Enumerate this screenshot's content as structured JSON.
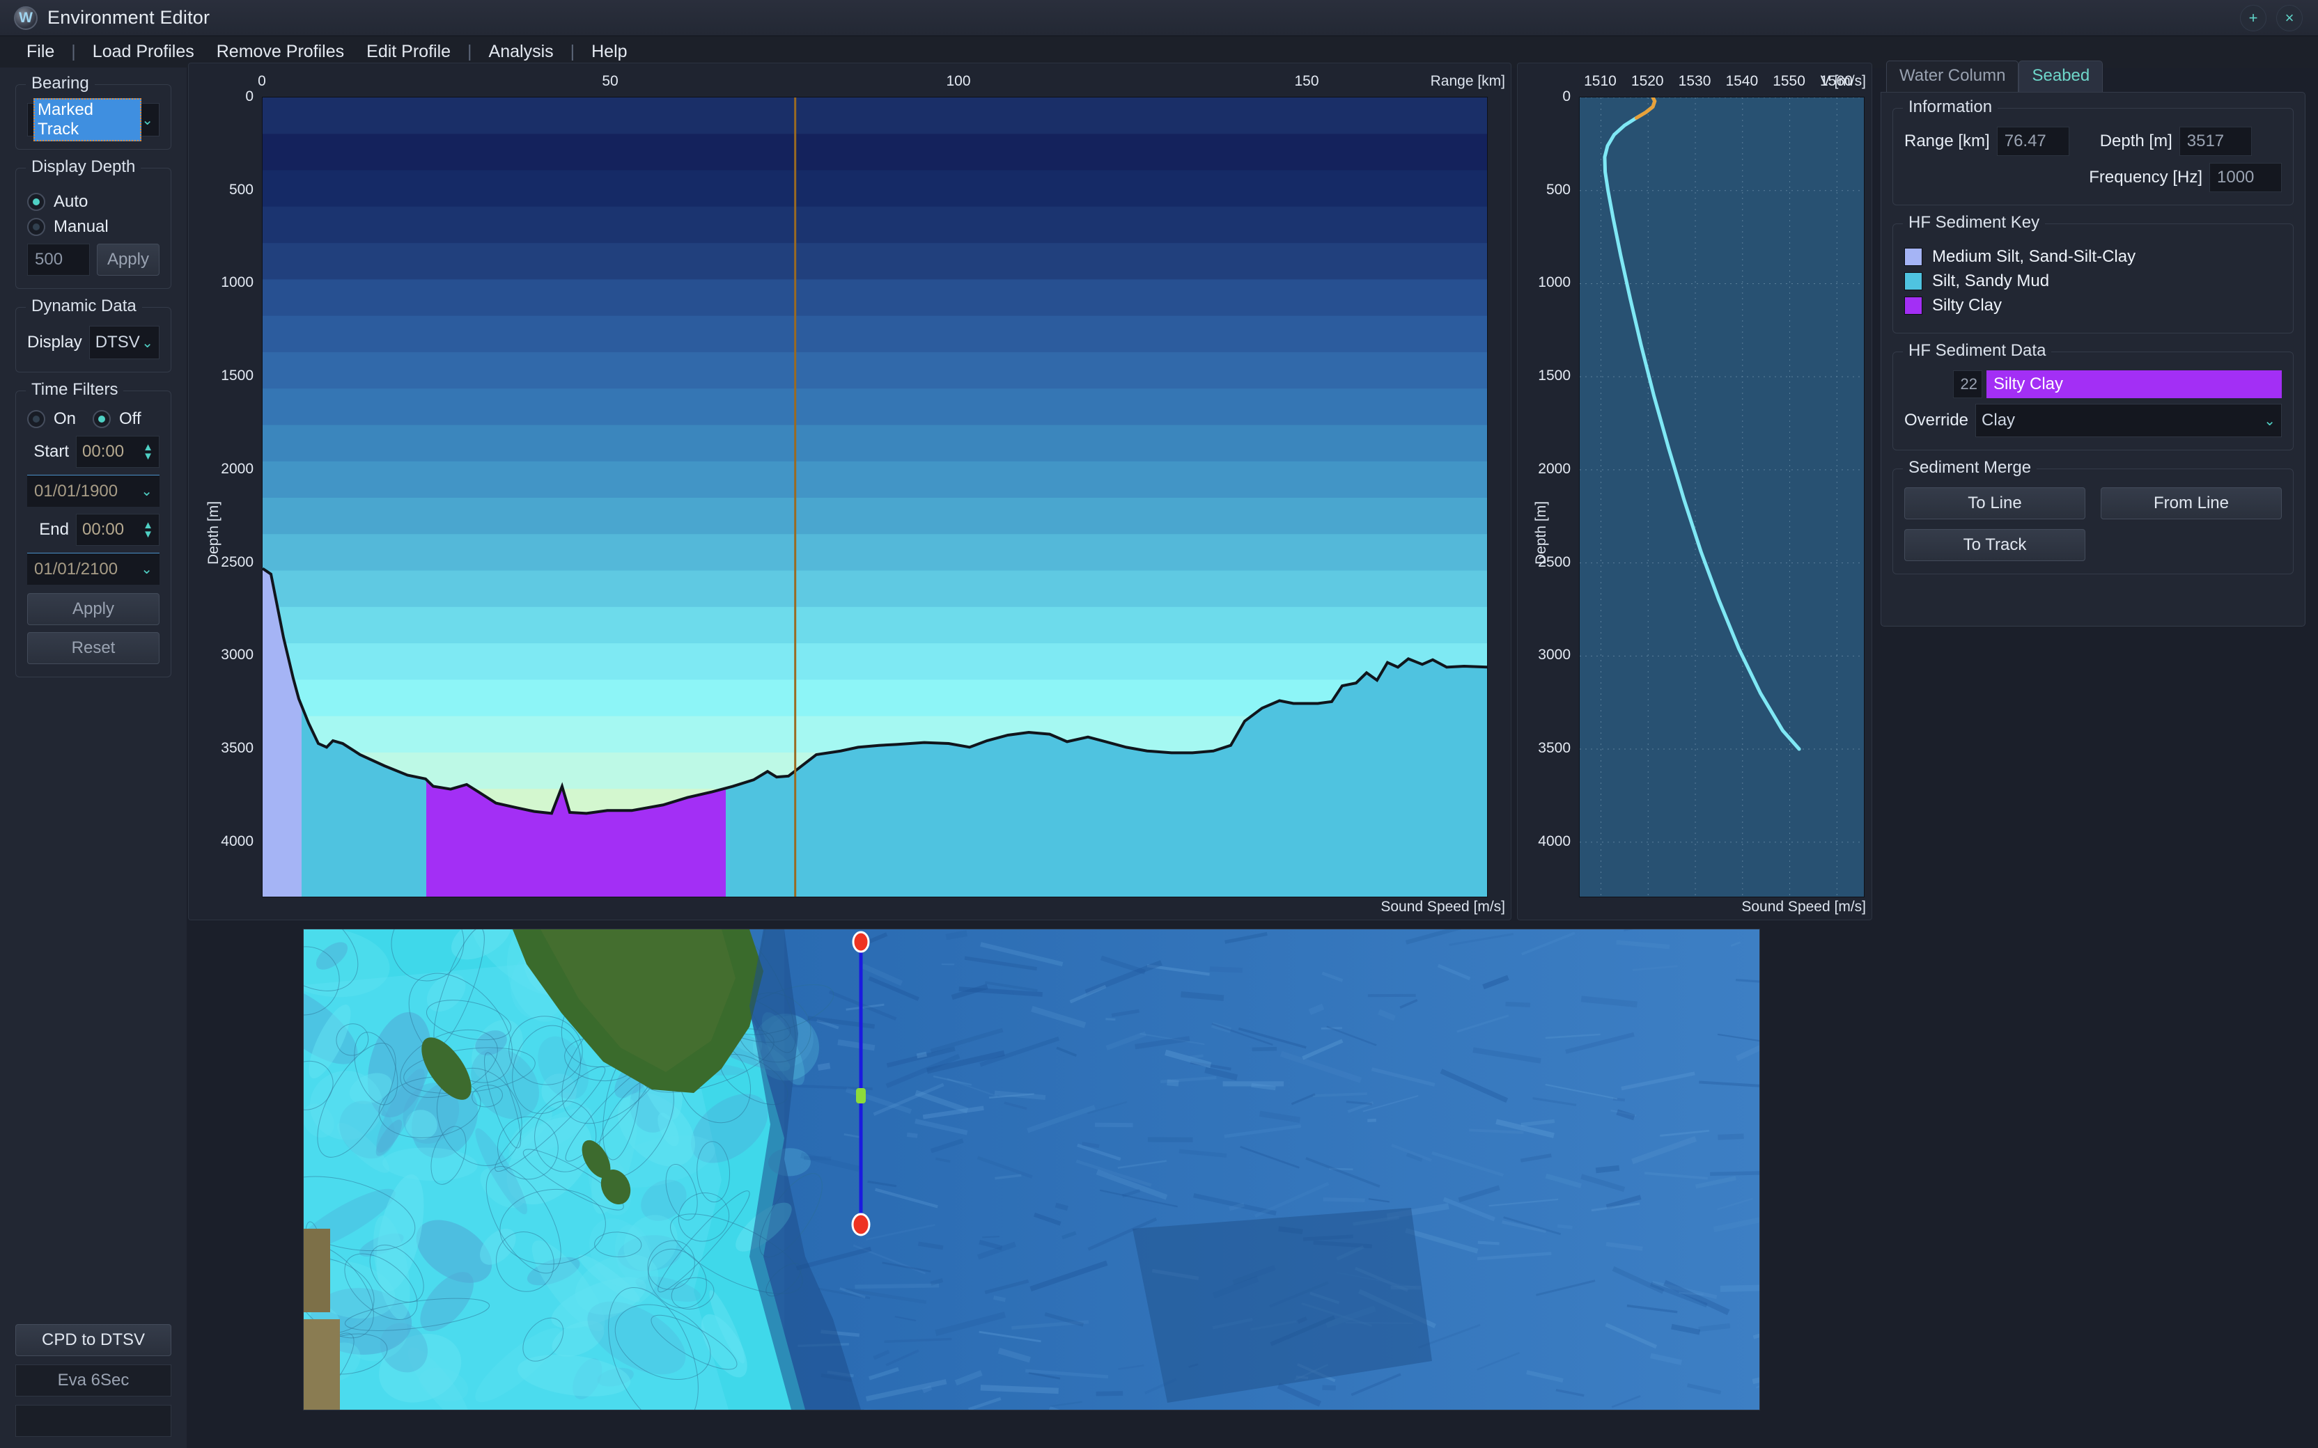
{
  "window": {
    "title": "Environment Editor",
    "logo_icon": "app-logo-icon",
    "maximize_label": "+",
    "close_label": "×"
  },
  "menu": {
    "items": [
      "File",
      "|",
      "Load Profiles",
      "Remove Profiles",
      "Edit Profile",
      "|",
      "Analysis",
      "|",
      "Help"
    ]
  },
  "sidebar": {
    "bearing": {
      "group_label": "Bearing",
      "selected": "Marked Track",
      "chevron": "⌄"
    },
    "display_depth": {
      "group_label": "Display Depth",
      "auto_label": "Auto",
      "manual_label": "Manual",
      "auto_selected": true,
      "manual_selected": false,
      "value": "500",
      "apply_label": "Apply"
    },
    "dynamic_data": {
      "group_label": "Dynamic Data",
      "display_label": "Display",
      "selected": "DTSV",
      "chevron": "⌄"
    },
    "time_filters": {
      "group_label": "Time Filters",
      "on_label": "On",
      "off_label": "Off",
      "on_selected": false,
      "off_selected": true,
      "start_label": "Start",
      "start_time": "00:00",
      "start_date": "01/01/1900",
      "end_label": "End",
      "end_time": "00:00",
      "end_date": "01/01/2100",
      "apply_label": "Apply",
      "reset_label": "Reset",
      "chevron": "⌄"
    },
    "bottom": {
      "cpd_to_dtsv_label": "CPD to DTSV",
      "eva_label": "Eva 6Sec"
    }
  },
  "right_panel": {
    "tabs": [
      {
        "label": "Water Column",
        "active": false
      },
      {
        "label": "Seabed",
        "active": true
      }
    ],
    "information": {
      "group_label": "Information",
      "range_label": "Range [km]",
      "range_value": "76.47",
      "depth_label": "Depth [m]",
      "depth_value": "3517",
      "frequency_label": "Frequency [Hz]",
      "frequency_value": "1000"
    },
    "sediment_key": {
      "group_label": "HF Sediment Key",
      "items": [
        {
          "label": "Medium Silt, Sand-Silt-Clay",
          "color": "#a5b4f5"
        },
        {
          "label": "Silt, Sandy Mud",
          "color": "#4fc3e0"
        },
        {
          "label": "Silty Clay",
          "color": "#a32ff5"
        }
      ]
    },
    "sediment_data": {
      "group_label": "HF Sediment Data",
      "index": "22",
      "name": "Silty Clay",
      "highlight_color": "#a32ff5",
      "override_label": "Override",
      "override_value": "Clay",
      "chevron": "⌄"
    },
    "sediment_merge": {
      "group_label": "Sediment Merge",
      "to_line_label": "To Line",
      "from_line_label": "From Line",
      "to_track_label": "To Track"
    }
  },
  "chart_data": [
    {
      "type": "area",
      "name": "range-depth-profile",
      "title": "",
      "xlabel_top": "Range [km]",
      "xlabel_bottom": "Sound Speed [m/s]",
      "ylabel": "Depth [m]",
      "xticks": [
        0,
        50,
        100,
        150
      ],
      "xlim": [
        0,
        176
      ],
      "yticks": [
        0,
        500,
        1000,
        1500,
        2000,
        2500,
        3000,
        3500,
        4000
      ],
      "ylim": [
        0,
        4300
      ],
      "grid": false,
      "cursor_range_km": 76.47,
      "water_column_bands": [
        "#1a2f68",
        "#14225c",
        "#152a66",
        "#1b3470",
        "#21407d",
        "#275091",
        "#2c5c9e",
        "#3169aa",
        "#3576b4",
        "#3b86bd",
        "#4295c6",
        "#4aa6cf",
        "#54b8d9",
        "#5fc9e2",
        "#6ddbeb",
        "#7ee9f3",
        "#8df5f7",
        "#a5f8f2",
        "#bdf9e6",
        "#d3f7cf",
        "#e6f5b5",
        "#f2f2a0"
      ],
      "seabed_profile": [
        [
          0,
          2530
        ],
        [
          1.2,
          2560
        ],
        [
          3.0,
          2900
        ],
        [
          4.4,
          3120
        ],
        [
          5.2,
          3230
        ],
        [
          6.6,
          3360
        ],
        [
          8.0,
          3470
        ],
        [
          9.2,
          3490
        ],
        [
          10.1,
          3455
        ],
        [
          11.5,
          3470
        ],
        [
          14.0,
          3530
        ],
        [
          17.5,
          3590
        ],
        [
          20.8,
          3640
        ],
        [
          23.4,
          3660
        ],
        [
          24.5,
          3700
        ],
        [
          27.0,
          3715
        ],
        [
          29.3,
          3690
        ],
        [
          31.0,
          3730
        ],
        [
          33.5,
          3790
        ],
        [
          36.5,
          3815
        ],
        [
          39.0,
          3835
        ],
        [
          41.5,
          3845
        ],
        [
          43.0,
          3700
        ],
        [
          44.1,
          3840
        ],
        [
          46.5,
          3845
        ],
        [
          49.5,
          3830
        ],
        [
          53.0,
          3830
        ],
        [
          57.5,
          3800
        ],
        [
          61.0,
          3760
        ],
        [
          64.5,
          3730
        ],
        [
          67.5,
          3700
        ],
        [
          70.5,
          3665
        ],
        [
          72.5,
          3620
        ],
        [
          73.8,
          3650
        ],
        [
          75.5,
          3645
        ],
        [
          79.5,
          3530
        ],
        [
          83.0,
          3510
        ],
        [
          85.5,
          3490
        ],
        [
          88.5,
          3480
        ],
        [
          91.0,
          3475
        ],
        [
          95.0,
          3465
        ],
        [
          98.5,
          3470
        ],
        [
          101.5,
          3490
        ],
        [
          104.0,
          3455
        ],
        [
          107.0,
          3425
        ],
        [
          110.0,
          3410
        ],
        [
          113.0,
          3420
        ],
        [
          115.5,
          3460
        ],
        [
          118.5,
          3435
        ],
        [
          121.0,
          3460
        ],
        [
          124.0,
          3490
        ],
        [
          127.0,
          3510
        ],
        [
          130.5,
          3520
        ],
        [
          133.5,
          3520
        ],
        [
          136.5,
          3510
        ],
        [
          139.0,
          3480
        ],
        [
          141.0,
          3350
        ],
        [
          143.5,
          3280
        ],
        [
          146.0,
          3240
        ],
        [
          148.0,
          3255
        ],
        [
          151.5,
          3255
        ],
        [
          153.5,
          3245
        ],
        [
          155.0,
          3160
        ],
        [
          157.0,
          3145
        ],
        [
          158.5,
          3090
        ],
        [
          160.0,
          3130
        ],
        [
          161.5,
          3035
        ],
        [
          163.0,
          3060
        ],
        [
          164.5,
          3015
        ],
        [
          166.5,
          3045
        ],
        [
          168.0,
          3020
        ],
        [
          170.0,
          3060
        ],
        [
          172.5,
          3055
        ],
        [
          176.0,
          3060
        ]
      ],
      "sediment_bands": [
        {
          "x0": 0.0,
          "x1": 5.6,
          "color": "#a5b4f5",
          "sediment": "Medium Silt, Sand-Silt-Clay"
        },
        {
          "x0": 5.6,
          "x1": 23.5,
          "color": "#4fc3e0",
          "sediment": "Silt, Sandy Mud"
        },
        {
          "x0": 23.5,
          "x1": 45.0,
          "color": "#a32ff5",
          "sediment": "Silty Clay"
        },
        {
          "x0": 45.0,
          "x1": 66.5,
          "color": "#a32ff5",
          "sediment": "Silty Clay"
        },
        {
          "x0": 66.5,
          "x1": 176.0,
          "color": "#4fc3e0",
          "sediment": "Silt, Sandy Mud"
        }
      ]
    },
    {
      "type": "line",
      "name": "sound-speed-profile",
      "xlabel_top": "V [m/s]",
      "xlabel_bottom": "Sound Speed [m/s]",
      "ylabel": "Depth [m]",
      "xticks": [
        1510,
        1520,
        1530,
        1540,
        1550,
        1560
      ],
      "xlim": [
        1505.5,
        1566
      ],
      "yticks": [
        0,
        500,
        1000,
        1500,
        2000,
        2500,
        3000,
        3500,
        4000
      ],
      "ylim": [
        0,
        4300
      ],
      "grid": true,
      "line_color": "#7fe8f5",
      "series": [
        {
          "name": "sound speed",
          "points": [
            [
              1521.0,
              0
            ],
            [
              1521.4,
              20
            ],
            [
              1521.0,
              50
            ],
            [
              1519.5,
              80
            ],
            [
              1517.5,
              110
            ],
            [
              1515.0,
              150
            ],
            [
              1512.8,
              200
            ],
            [
              1511.4,
              260
            ],
            [
              1510.8,
              320
            ],
            [
              1510.9,
              400
            ],
            [
              1511.5,
              500
            ],
            [
              1512.6,
              650
            ],
            [
              1514.2,
              850
            ],
            [
              1516.2,
              1080
            ],
            [
              1518.5,
              1330
            ],
            [
              1521.2,
              1600
            ],
            [
              1524.3,
              1880
            ],
            [
              1527.6,
              2160
            ],
            [
              1531.2,
              2440
            ],
            [
              1535.0,
              2700
            ],
            [
              1539.2,
              2960
            ],
            [
              1543.8,
              3200
            ],
            [
              1548.5,
              3400
            ],
            [
              1552.0,
              3500
            ]
          ]
        }
      ]
    }
  ],
  "map": {
    "name": "bathymetry-map",
    "track": {
      "start_marker_color": "#ee3322",
      "end_marker_color": "#ee3322",
      "line_color": "#1a1ae0",
      "cursor_marker_color": "#8ddb3a"
    }
  }
}
